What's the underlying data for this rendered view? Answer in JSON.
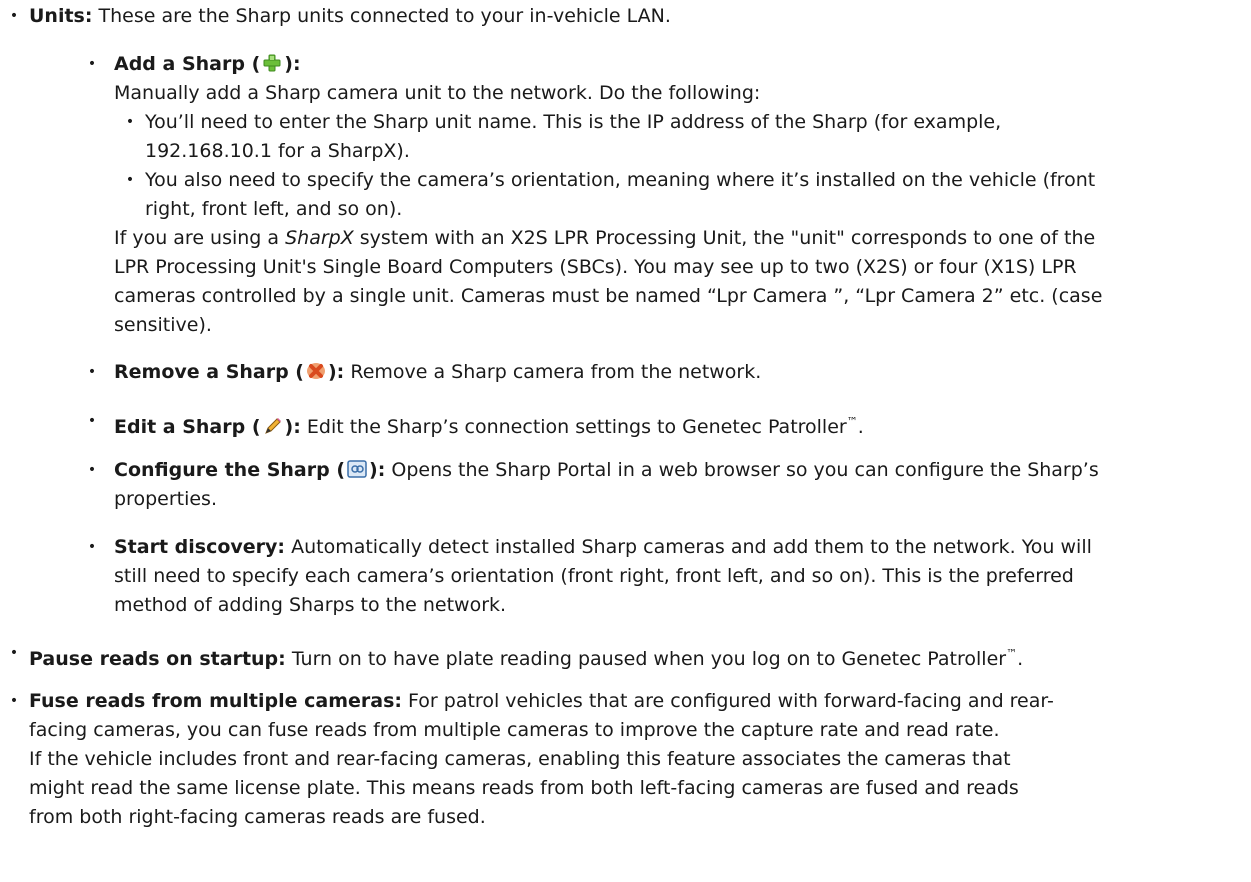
{
  "units": {
    "term": "Units:",
    "desc": "These are the Sharp units connected to your in-vehicle LAN."
  },
  "add_sharp": {
    "term_open": "Add a Sharp (",
    "icon": "add-plus-icon",
    "term_close": "):",
    "intro": "Manually add a Sharp camera unit to the network. Do the following:",
    "step1_line1": "You’ll need to enter the Sharp unit name. This is the IP address of the Sharp (for example,",
    "step1_line2": "192.168.10.1 for a SharpX).",
    "step2_line1": "You also need to specify the camera’s orientation, meaning where it’s installed on the vehicle (front",
    "step2_line2": "right, front left, and so on).",
    "note_l1a": "If you are using a ",
    "note_l1_italic": "SharpX",
    "note_l1b": " system with an X2S LPR Processing Unit, the \"unit\" corresponds to one of the",
    "note_l2": "LPR Processing Unit's Single Board Computers (SBCs). You may see up to two (X2S) or four (X1S) LPR",
    "note_l3": "cameras controlled by a single unit. Cameras must be named “Lpr Camera ”, “Lpr Camera 2” etc. (case",
    "note_l4": "sensitive)."
  },
  "remove_sharp": {
    "term_open": "Remove a Sharp (",
    "icon": "remove-x-icon",
    "term_close": "):",
    "desc": "Remove a Sharp camera from the network."
  },
  "edit_sharp": {
    "term_open": "Edit a Sharp (",
    "icon": "pencil-icon",
    "term_close": "):",
    "desc": "Edit the Sharp’s connection settings to Genetec Patroller",
    "tm": "™",
    "end": "."
  },
  "configure_sharp": {
    "term_open": "Configure the Sharp (",
    "icon": "portal-icon",
    "term_close": "):",
    "desc_l1": "Opens the Sharp Portal in a web browser so you can configure the Sharp’s",
    "desc_l2": "properties."
  },
  "start_discovery": {
    "term": "Start discovery:",
    "l1": "Automatically detect installed Sharp cameras and add them to the network. You will",
    "l2": "still need to specify each camera’s orientation (front right, front left, and so on). This is the preferred",
    "l3": "method of adding Sharps to the network."
  },
  "pause_reads": {
    "term": "Pause reads on startup:",
    "desc": "Turn on to have plate reading paused when you log on to Genetec Patroller",
    "tm": "™",
    "end": "."
  },
  "fuse_reads": {
    "term": "Fuse reads from multiple cameras:",
    "l1": "For patrol vehicles that are configured with forward-facing and rear-",
    "l2": "facing cameras, you can fuse reads from multiple cameras to improve the capture rate and read rate.",
    "l3": "If the vehicle includes front and rear-facing cameras, enabling this feature associates the cameras that",
    "l4": "might read the same license plate. This means reads from both left-facing cameras are fused and reads",
    "l5": "from both right-facing cameras reads are fused.",
    "l6": ""
  }
}
